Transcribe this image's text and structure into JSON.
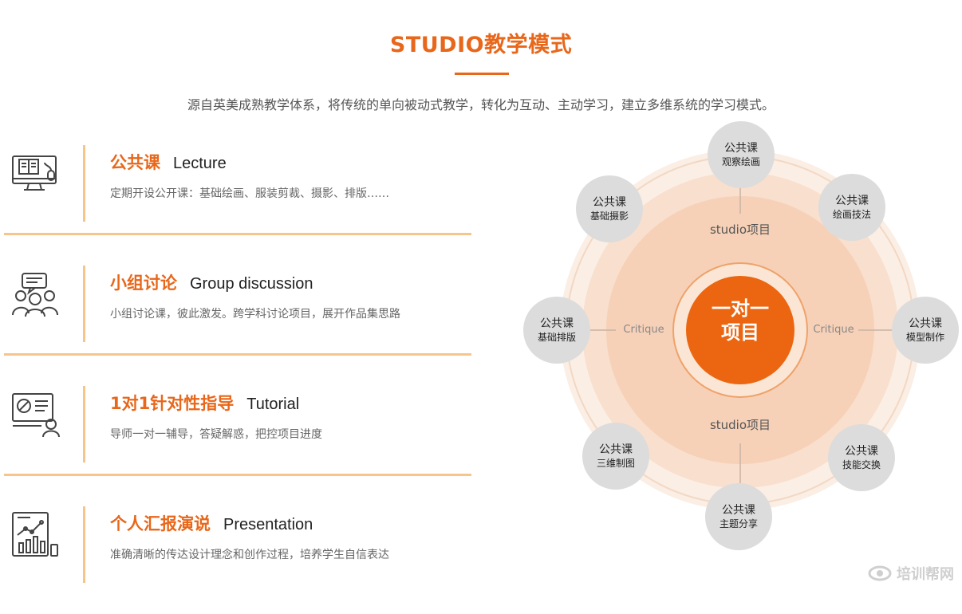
{
  "header": {
    "title": "STUDIO教学模式",
    "subtitle": "源自英美成熟教学体系，将传统的单向被动式教学，转化为互动、主动学习，建立多维系统的学习模式。"
  },
  "items": [
    {
      "cn": "公共课",
      "en": "Lecture",
      "desc": "定期开设公开课：基础绘画、服装剪裁、摄影、排版……",
      "icon": "computer-lecture-icon"
    },
    {
      "cn": "小组讨论",
      "en": "Group discussion",
      "desc": "小组讨论课，彼此激发。跨学科讨论项目，展开作品集思路",
      "icon": "group-discussion-icon"
    },
    {
      "cn": "1对1针对性指导",
      "en": "Tutorial",
      "desc": "导师一对一辅导，答疑解惑，把控项目进度",
      "icon": "tutor-board-icon"
    },
    {
      "cn": "个人汇报演说",
      "en": "Presentation",
      "desc": "准确清晰的传达设计理念和创作过程，培养学生自信表达",
      "icon": "chart-report-icon"
    }
  ],
  "diagram": {
    "center": {
      "line1": "一对一",
      "line2": "项目"
    },
    "ring_top": "studio项目",
    "ring_bottom": "studio项目",
    "critique_left": "Critique",
    "critique_right": "Critique",
    "nodes": [
      {
        "l1": "公共课",
        "l2": "观察绘画"
      },
      {
        "l1": "公共课",
        "l2": "绘画技法"
      },
      {
        "l1": "公共课",
        "l2": "模型制作"
      },
      {
        "l1": "公共课",
        "l2": "技能交换"
      },
      {
        "l1": "公共课",
        "l2": "主题分享"
      },
      {
        "l1": "公共课",
        "l2": "三维制图"
      },
      {
        "l1": "公共课",
        "l2": "基础排版"
      },
      {
        "l1": "公共课",
        "l2": "基础摄影"
      }
    ]
  },
  "watermark": "培训帮网",
  "colors": {
    "accent": "#e8671a",
    "rule": "#f7c58a",
    "node": "#dcdcdc"
  }
}
